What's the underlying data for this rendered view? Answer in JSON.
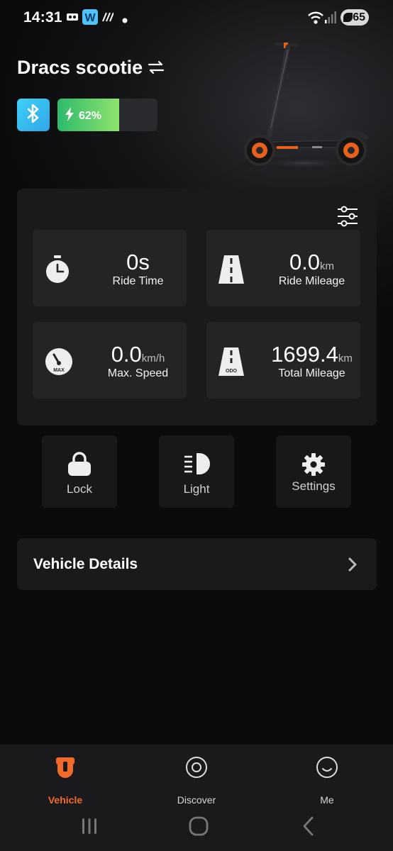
{
  "status_bar": {
    "time": "14:31",
    "battery": "65",
    "icons": [
      "voicemail-icon",
      "app-w-icon",
      "stripes-icon",
      "dot-icon",
      "wifi-icon",
      "signal-icon",
      "battery-icon"
    ]
  },
  "vehicle": {
    "name": "Dracs scootie",
    "battery_percent": "62%",
    "battery_fraction": 0.62
  },
  "stats": [
    {
      "value": "0s",
      "unit": "",
      "label": "Ride Time",
      "icon": "stopwatch-icon"
    },
    {
      "value": "0.0",
      "unit": "km",
      "label": "Ride Mileage",
      "icon": "road-icon"
    },
    {
      "value": "0.0",
      "unit": "km/h",
      "label": "Max. Speed",
      "icon": "speedometer-icon",
      "icon_text": "MAX"
    },
    {
      "value": "1699.4",
      "unit": "km",
      "label": "Total Mileage",
      "icon": "odometer-road-icon",
      "icon_text": "ODO"
    }
  ],
  "actions": [
    {
      "label": "Lock",
      "icon": "lock-icon"
    },
    {
      "label": "Light",
      "icon": "headlight-icon"
    },
    {
      "label": "Settings",
      "icon": "gear-icon"
    }
  ],
  "details": {
    "label": "Vehicle Details"
  },
  "nav": {
    "items": [
      {
        "label": "Vehicle",
        "icon": "vehicle-icon",
        "active": true
      },
      {
        "label": "Discover",
        "icon": "discover-icon",
        "active": false
      },
      {
        "label": "Me",
        "icon": "smiley-icon",
        "active": false
      }
    ]
  },
  "colors": {
    "accent": "#f26a2a",
    "bluetooth": "#3fd0f6",
    "battery_green": "#2dbb6c",
    "background": "#0b0b0c",
    "card": "#1a1a1c"
  }
}
